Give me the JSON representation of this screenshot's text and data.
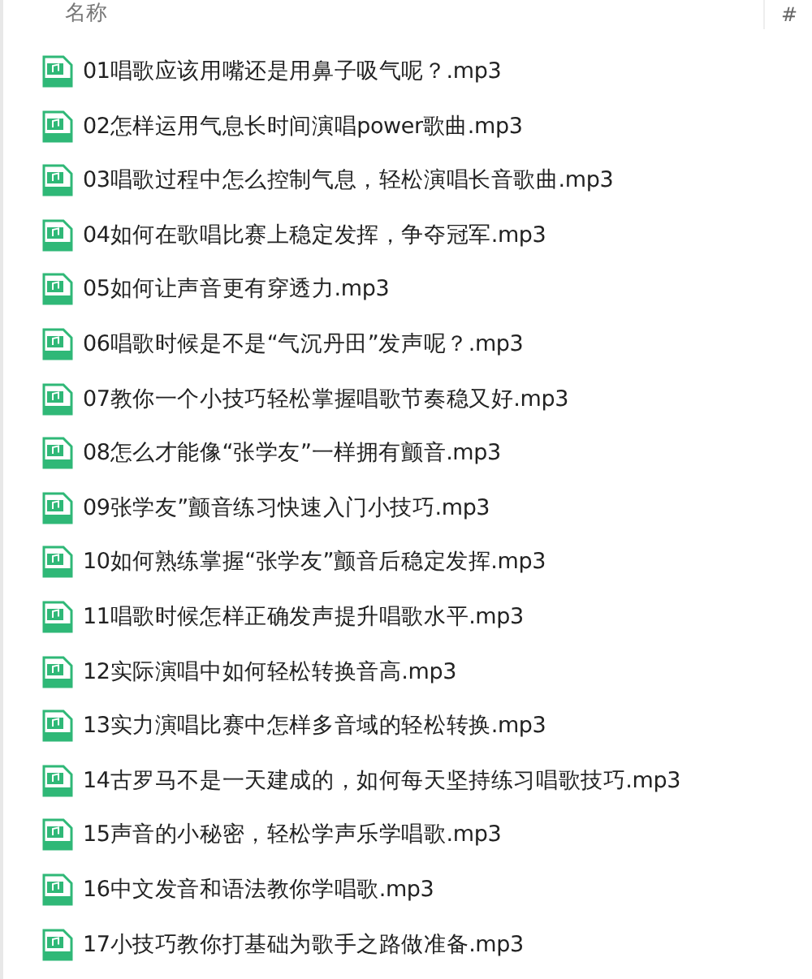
{
  "columns": [
    "名称",
    "#"
  ],
  "files": [
    {
      "name": "01唱歌应该用嘴还是用鼻子吸气呢？.mp3"
    },
    {
      "name": "02怎样运用气息长时间演唱power歌曲.mp3"
    },
    {
      "name": "03唱歌过程中怎么控制气息，轻松演唱长音歌曲.mp3"
    },
    {
      "name": "04如何在歌唱比赛上稳定发挥，争夺冠军.mp3"
    },
    {
      "name": "05如何让声音更有穿透力.mp3"
    },
    {
      "name": "06唱歌时候是不是“气沉丹田”发声呢？.mp3"
    },
    {
      "name": "07教你一个小技巧轻松掌握唱歌节奏稳又好.mp3"
    },
    {
      "name": "08怎么才能像“张学友”一样拥有颤音.mp3"
    },
    {
      "name": "09张学友”颤音练习快速入门小技巧.mp3"
    },
    {
      "name": "10如何熟练掌握“张学友”颤音后稳定发挥.mp3"
    },
    {
      "name": "11唱歌时候怎样正确发声提升唱歌水平.mp3"
    },
    {
      "name": "12实际演唱中如何轻松转换音高.mp3"
    },
    {
      "name": "13实力演唱比赛中怎样多音域的轻松转换.mp3"
    },
    {
      "name": "14古罗马不是一天建成的，如何每天坚持练习唱歌技巧.mp3"
    },
    {
      "name": "15声音的小秘密，轻松学声乐学唱歌.mp3"
    },
    {
      "name": "16中文发音和语法教你学唱歌.mp3"
    },
    {
      "name": "17小技巧教你打基础为歌手之路做准备.mp3"
    }
  ]
}
